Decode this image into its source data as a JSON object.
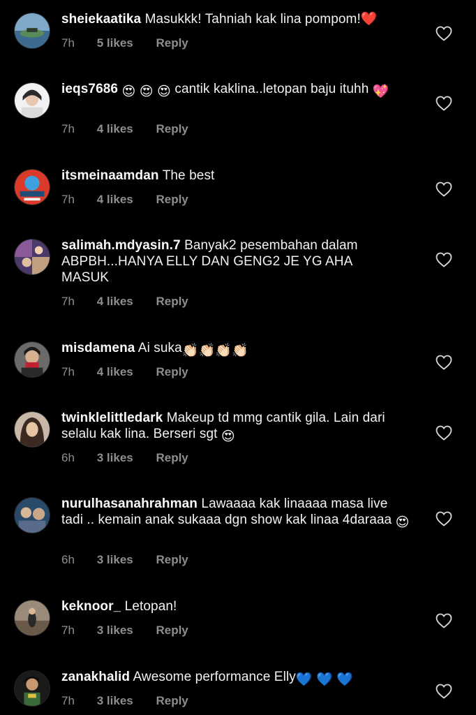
{
  "comments": [
    {
      "username": "sheiekaatika",
      "text": "Masukkk! Tahniah kak lina pompom!",
      "emoji_suffix": "❤️",
      "time": "7h",
      "likes": "5 likes",
      "reply": "Reply"
    },
    {
      "username": "ieqs7686",
      "text": "cantik kaklina..letopan baju ituhh",
      "emoji_prefix": "😍 😍 😍",
      "emoji_suffix": "💖",
      "time": "7h",
      "likes": "4 likes",
      "reply": "Reply"
    },
    {
      "username": "itsmeinaamdan",
      "text": "The best",
      "time": "7h",
      "likes": "4 likes",
      "reply": "Reply"
    },
    {
      "username": "salimah.mdyasin.7",
      "text": "Banyak2 pesembahan dalam ABPBH...HANYA ELLY DAN GENG2 JE YG AHA MASUK",
      "time": "7h",
      "likes": "4 likes",
      "reply": "Reply"
    },
    {
      "username": "misdamena",
      "text": "Ai suka",
      "emoji_suffix": "👏🏻👏🏻👏🏻👏🏻",
      "time": "7h",
      "likes": "4 likes",
      "reply": "Reply"
    },
    {
      "username": "twinklelittledark",
      "text": "Makeup td mmg cantik gila. Lain dari selalu kak lina. Berseri sgt",
      "emoji_suffix": "😍",
      "time": "6h",
      "likes": "3 likes",
      "reply": "Reply"
    },
    {
      "username": "nurulhasanahrahman",
      "text": "Lawaaaa kak linaaaa masa live tadi .. kemain anak sukaaa dgn show kak linaa 4daraaa",
      "emoji_suffix": "😍",
      "time": "6h",
      "likes": "3 likes",
      "reply": "Reply"
    },
    {
      "username": "keknoor_",
      "text": "Letopan!",
      "time": "7h",
      "likes": "3 likes",
      "reply": "Reply"
    },
    {
      "username": "zanakhalid",
      "text": "Awesome performance Elly",
      "emoji_suffix": "💙 💙 💙",
      "time": "7h",
      "likes": "3 likes",
      "reply": "Reply"
    }
  ],
  "colors": {
    "background": "#000000",
    "text": "#f2f2f2",
    "muted": "#8e8e8e",
    "heart_red": "#e0245e",
    "heart_blue": "#1877f2"
  },
  "icons": {
    "like": "heart-outline-icon"
  }
}
